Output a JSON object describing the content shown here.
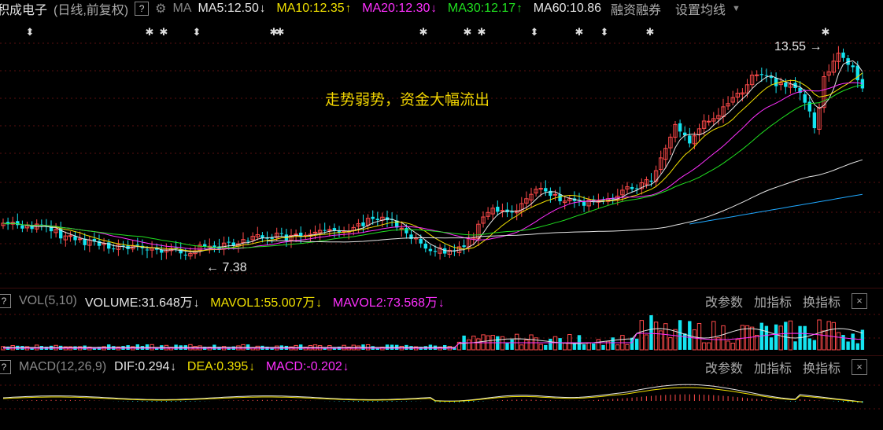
{
  "header": {
    "stock_name": "积成电子",
    "mode": "(日线,前复权)",
    "help": "?",
    "indicator": "MA",
    "ma_items": [
      {
        "label": "MA5:12.50",
        "arrow": "↓",
        "color": "#e6e6e6"
      },
      {
        "label": "MA10:12.35",
        "arrow": "↑",
        "color": "#f0e000"
      },
      {
        "label": "MA20:12.30",
        "arrow": "↓",
        "color": "#ff30ff"
      },
      {
        "label": "MA30:12.17",
        "arrow": "↑",
        "color": "#20e020"
      },
      {
        "label": "MA60:10.86",
        "arrow": "",
        "color": "#e6e6e6"
      }
    ],
    "margin_label": "融资融券",
    "settings_label": "设置均线"
  },
  "annotation": "走势弱势，资金大幅流出",
  "price_labels": {
    "high": "13.55",
    "low": "7.38"
  },
  "vol_panel": {
    "help": "?",
    "name": "VOL(5,10)",
    "items": [
      {
        "label": "VOLUME:31.648万",
        "arrow": "↓",
        "color": "#e6e6e6"
      },
      {
        "label": "MAVOL1:55.007万",
        "arrow": "↓",
        "color": "#f0e000"
      },
      {
        "label": "MAVOL2:73.568万",
        "arrow": "↓",
        "color": "#ff30ff"
      }
    ],
    "tools": [
      "改参数",
      "加指标",
      "换指标"
    ],
    "close": "×"
  },
  "macd_panel": {
    "help": "?",
    "name": "MACD(12,26,9)",
    "items": [
      {
        "label": "DIF:0.294",
        "arrow": "↓",
        "color": "#e6e6e6"
      },
      {
        "label": "DEA:0.395",
        "arrow": "↓",
        "color": "#f0e000"
      },
      {
        "label": "MACD:-0.202",
        "arrow": "↓",
        "color": "#ff30ff"
      }
    ],
    "tools": [
      "改参数",
      "加指标",
      "换指标"
    ],
    "close": "×"
  },
  "colors": {
    "up": "#ff4a4a",
    "down": "#14e4f0",
    "ma5": "#e6e6e6",
    "ma10": "#f0e000",
    "ma20": "#ff30ff",
    "ma30": "#20e020",
    "ma60": "#e6e6e6",
    "ma120": "#1fa8ff"
  }
}
